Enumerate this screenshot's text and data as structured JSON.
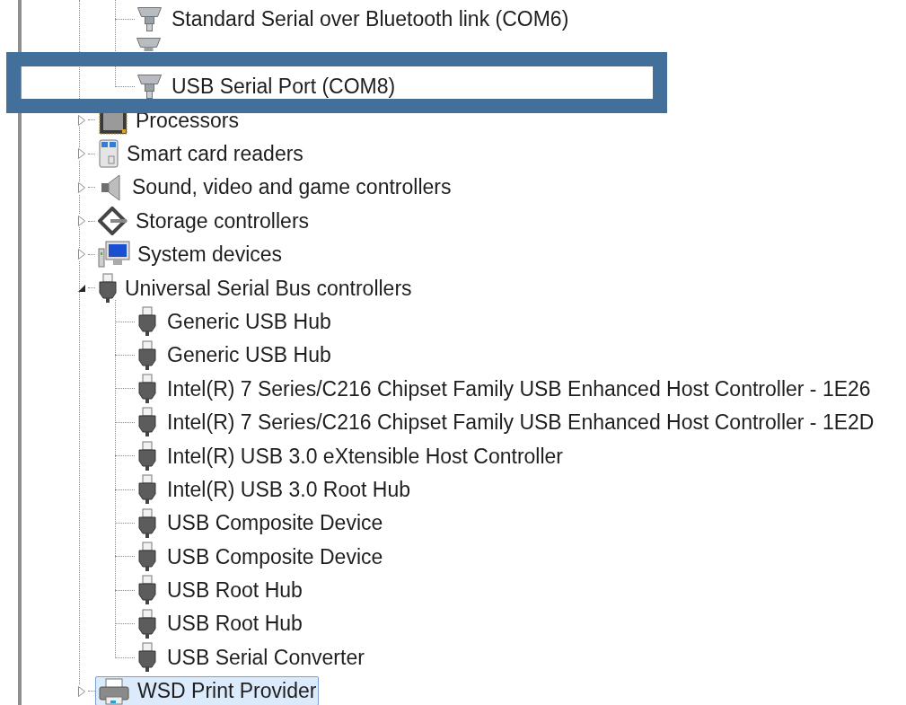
{
  "tree": {
    "ports_continued": [
      {
        "label": "Standard Serial over Bluetooth link (COM6)",
        "kind": "serial-port",
        "highlighted": false
      },
      {
        "kind": "serial-port",
        "highlighted": false
      },
      {
        "label": "USB Serial Port (COM8)",
        "kind": "serial-port",
        "highlighted": true
      }
    ],
    "categories": [
      {
        "label": "Processors",
        "kind": "processor",
        "expanded": false,
        "selected": false
      },
      {
        "label": "Smart card readers",
        "kind": "smart-card",
        "expanded": false,
        "selected": false
      },
      {
        "label": "Sound, video and game controllers",
        "kind": "speaker",
        "expanded": false,
        "selected": false
      },
      {
        "label": "Storage controllers",
        "kind": "storage",
        "expanded": false,
        "selected": false
      },
      {
        "label": "System devices",
        "kind": "computer",
        "expanded": false,
        "selected": false
      },
      {
        "label": "Universal Serial Bus controllers",
        "kind": "usb",
        "expanded": true,
        "selected": false,
        "children": [
          {
            "label": "Generic USB Hub",
            "kind": "usb",
            "highlighted": false
          },
          {
            "label": "Generic USB Hub",
            "kind": "usb",
            "highlighted": false
          },
          {
            "label": "Intel(R) 7 Series/C216 Chipset Family USB Enhanced Host Controller - 1E26",
            "kind": "usb",
            "highlighted": false
          },
          {
            "label": "Intel(R) 7 Series/C216 Chipset Family USB Enhanced Host Controller - 1E2D",
            "kind": "usb",
            "highlighted": false
          },
          {
            "label": "Intel(R) USB 3.0 eXtensible Host Controller",
            "kind": "usb",
            "highlighted": false
          },
          {
            "label": "Intel(R) USB 3.0 Root Hub",
            "kind": "usb",
            "highlighted": false
          },
          {
            "label": "USB Composite Device",
            "kind": "usb",
            "highlighted": false
          },
          {
            "label": "USB Composite Device",
            "kind": "usb",
            "highlighted": false
          },
          {
            "label": "USB Root Hub",
            "kind": "usb",
            "highlighted": false
          },
          {
            "label": "USB Root Hub",
            "kind": "usb",
            "highlighted": false
          },
          {
            "label": "USB Serial Converter",
            "kind": "usb",
            "highlighted": false
          }
        ]
      },
      {
        "label": "WSD Print Provider",
        "kind": "printer",
        "expanded": false,
        "selected": true
      }
    ]
  }
}
